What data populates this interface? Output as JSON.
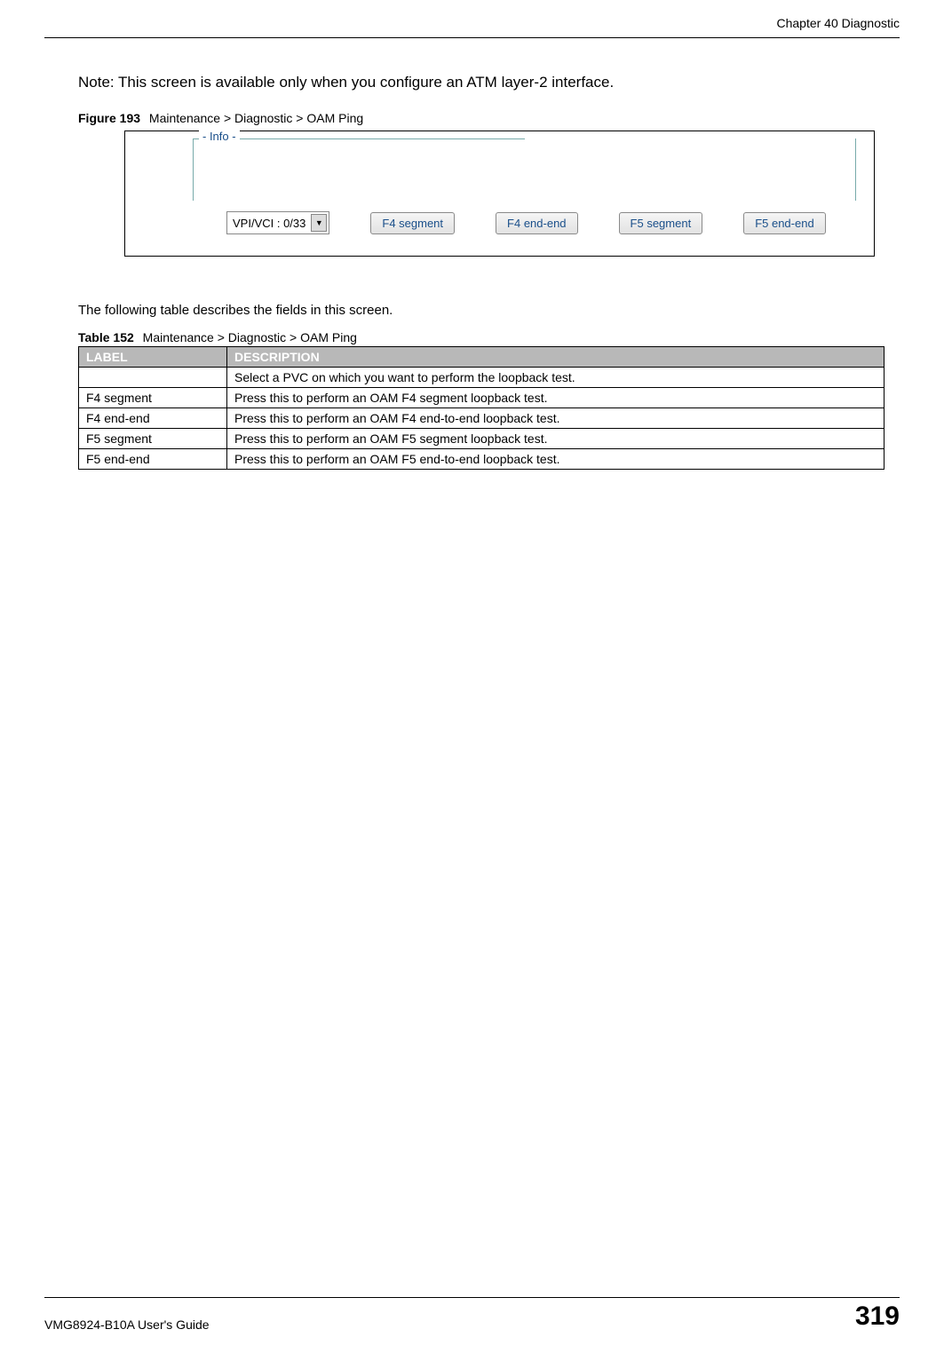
{
  "header": {
    "chapter": "Chapter 40 Diagnostic"
  },
  "note": "Note: This screen is available only when you configure an ATM layer-2 interface.",
  "figure": {
    "label": "Figure 193",
    "title": "Maintenance > Diagnostic > OAM Ping",
    "info_label": "- Info -",
    "dropdown_value": "VPI/VCI : 0/33",
    "buttons": {
      "f4_segment": "F4 segment",
      "f4_end_end": "F4 end-end",
      "f5_segment": "F5 segment",
      "f5_end_end": "F5 end-end"
    }
  },
  "following_text": "The following table describes the fields in this screen.",
  "table": {
    "label": "Table 152",
    "title": "Maintenance > Diagnostic > OAM Ping",
    "headers": {
      "label": "LABEL",
      "description": "DESCRIPTION"
    },
    "rows": [
      {
        "label": "",
        "desc": "Select a PVC on which you want to perform the loopback test."
      },
      {
        "label": "F4 segment",
        "desc": "Press this to perform an OAM F4 segment loopback test."
      },
      {
        "label": "F4 end-end",
        "desc": "Press this to perform an OAM F4 end-to-end loopback test."
      },
      {
        "label": "F5 segment",
        "desc": "Press this to perform an OAM F5 segment loopback test."
      },
      {
        "label": "F5 end-end",
        "desc": "Press this to perform an OAM F5 end-to-end loopback test."
      }
    ]
  },
  "footer": {
    "guide": "VMG8924-B10A User's Guide",
    "page": "319"
  }
}
